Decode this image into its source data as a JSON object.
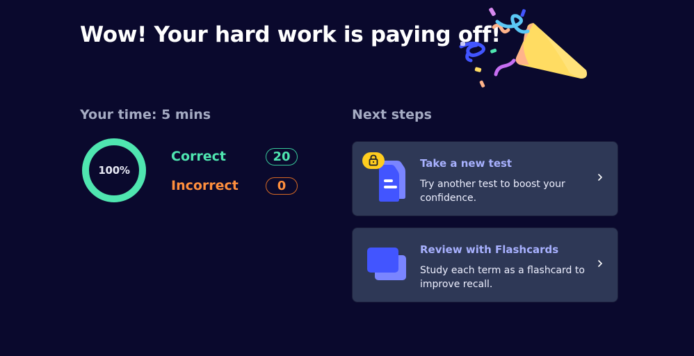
{
  "header": {
    "title": "Wow! Your hard work is paying off!"
  },
  "results": {
    "time_label": "Your time: 5 mins",
    "percent_text": "100%",
    "percent_value": 100,
    "correct": {
      "label": "Correct",
      "count": "20"
    },
    "incorrect": {
      "label": "Incorrect",
      "count": "0"
    }
  },
  "next_steps": {
    "heading": "Next steps",
    "cards": [
      {
        "title": "Take a new test",
        "description": "Try another test to boost your confidence.",
        "icon": "test-document-icon",
        "badge_icon": "lock-icon"
      },
      {
        "title": "Review with Flashcards",
        "description": "Study each term as a flashcard to improve recall.",
        "icon": "flashcards-icon"
      }
    ]
  },
  "colors": {
    "background": "#0a092d",
    "correct": "#4fe6b0",
    "incorrect": "#ff8f3d",
    "card_background": "#2e3856",
    "card_title": "#a8b1ff",
    "accent_blue": "#4255ff",
    "lock_badge": "#ffcd1f"
  }
}
